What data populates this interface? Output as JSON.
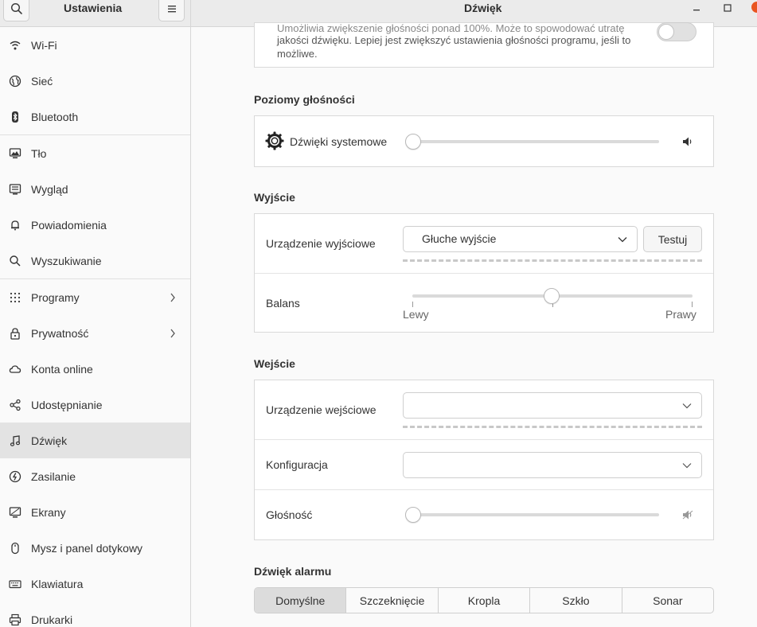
{
  "sidebar_header": {
    "title": "Ustawienia"
  },
  "window": {
    "title": "Dźwięk"
  },
  "sidebar": {
    "items": [
      {
        "label": "Wi-Fi"
      },
      {
        "label": "Sieć"
      },
      {
        "label": "Bluetooth"
      },
      {
        "label": "Tło"
      },
      {
        "label": "Wygląd"
      },
      {
        "label": "Powiadomienia"
      },
      {
        "label": "Wyszukiwanie"
      },
      {
        "label": "Programy"
      },
      {
        "label": "Prywatność"
      },
      {
        "label": "Konta online"
      },
      {
        "label": "Udostępnianie"
      },
      {
        "label": "Dźwięk"
      },
      {
        "label": "Zasilanie"
      },
      {
        "label": "Ekrany"
      },
      {
        "label": "Mysz i panel dotykowy"
      },
      {
        "label": "Klawiatura"
      },
      {
        "label": "Drukarki"
      }
    ],
    "active_item": "Dźwięk"
  },
  "overamp": {
    "text_line1": "Umożliwia zwiększenie głośności ponad 100%. Może to spowodować utratę",
    "text_line2": "jakości dźwięku. Lepiej jest zwiększyć ustawienia głośności programu, jeśli to",
    "text_line3": "możliwe.",
    "toggle_on": false
  },
  "levels": {
    "title": "Poziomy głośności",
    "system_sounds_label": "Dźwięki systemowe",
    "system_sounds_level": 0
  },
  "output": {
    "title": "Wyjście",
    "device_label": "Urządzenie wyjściowe",
    "device_value": "Głuche wyjście",
    "test_button": "Testuj",
    "balance_label": "Balans",
    "balance_left": "Lewy",
    "balance_right": "Prawy",
    "balance_value": 0.5
  },
  "input": {
    "title": "Wejście",
    "device_label": "Urządzenie wejściowe",
    "device_value": "",
    "config_label": "Konfiguracja",
    "config_value": "",
    "volume_label": "Głośność",
    "volume_level": 0
  },
  "alarm": {
    "title": "Dźwięk alarmu",
    "options": [
      "Domyślne",
      "Szczeknięcie",
      "Kropla",
      "Szkło",
      "Sonar"
    ],
    "selected": "Domyślne"
  }
}
